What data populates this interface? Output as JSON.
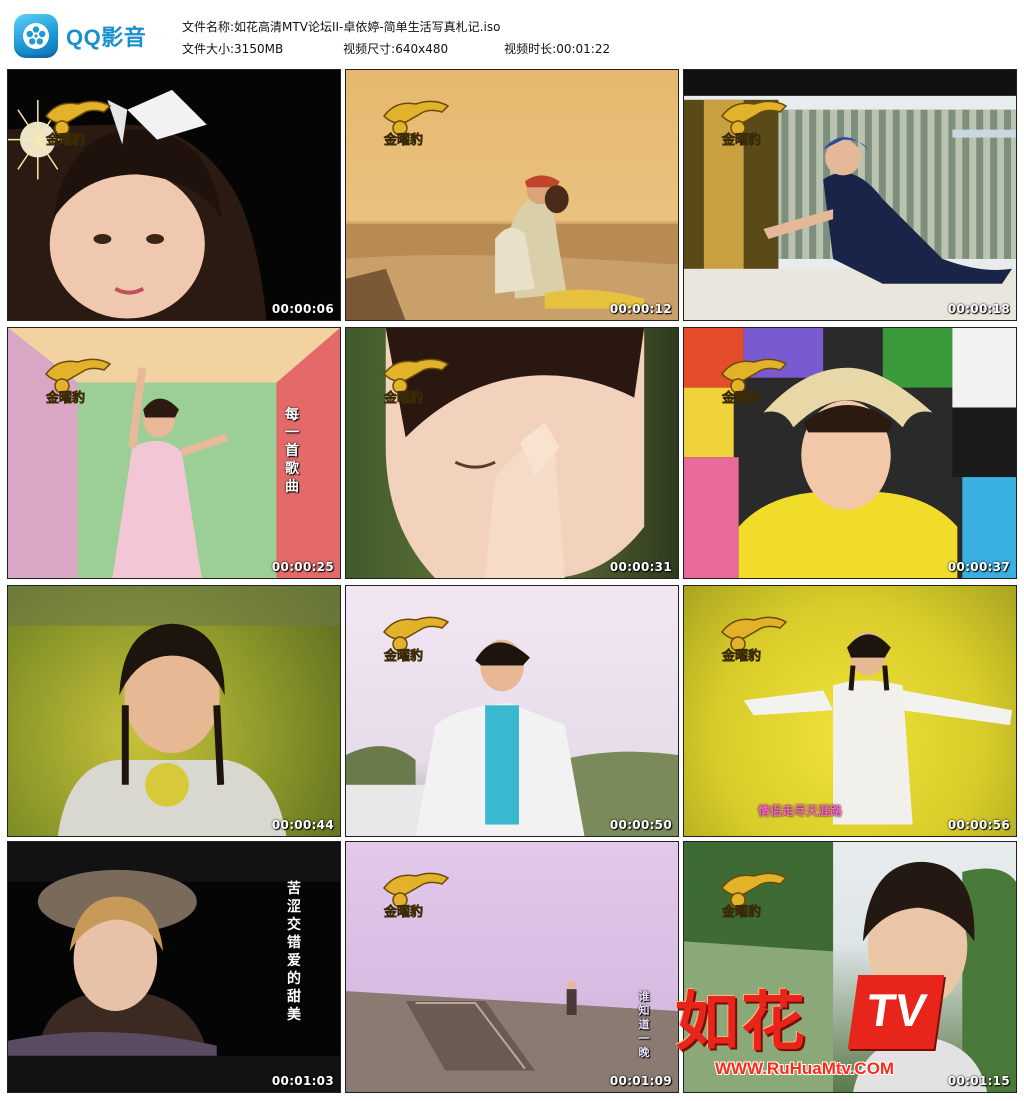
{
  "app": {
    "name": "QQ影音",
    "logo_icon": "film-reel-icon",
    "brand_color": "#1a8fd0"
  },
  "file_info": {
    "name_label": "文件名称:",
    "name_value": "如花高清MTV论坛II-卓依婷-简单生活写真札记.iso",
    "size_label": "文件大小:",
    "size_value": "3150MB",
    "dimensions_label": "视频尺寸:",
    "dimensions_value": "640x480",
    "duration_label": "视频时长:",
    "duration_value": "00:01:22"
  },
  "thumbnails": [
    {
      "timestamp": "00:00:06",
      "logo": "金曜豹",
      "caption": ""
    },
    {
      "timestamp": "00:00:12",
      "logo": "金曜豹",
      "caption": ""
    },
    {
      "timestamp": "00:00:18",
      "logo": "金曜豹",
      "caption": ""
    },
    {
      "timestamp": "00:00:25",
      "logo": "金曜豹",
      "caption": "每一首歌曲"
    },
    {
      "timestamp": "00:00:31",
      "logo": "金曜豹",
      "caption": ""
    },
    {
      "timestamp": "00:00:37",
      "logo": "金曜豹",
      "caption": ""
    },
    {
      "timestamp": "00:00:44",
      "logo": "",
      "caption": ""
    },
    {
      "timestamp": "00:00:50",
      "logo": "金曜豹",
      "caption": ""
    },
    {
      "timestamp": "00:00:56",
      "logo": "金曜豹",
      "caption": "情侣走尽天涯路"
    },
    {
      "timestamp": "00:01:03",
      "logo": "",
      "caption": "苦涩交错爱的甜美"
    },
    {
      "timestamp": "00:01:09",
      "logo": "金曜豹",
      "caption": "谁知道一晚"
    },
    {
      "timestamp": "00:01:15",
      "logo": "金曜豹",
      "caption": ""
    }
  ],
  "watermark": {
    "title": "如花",
    "badge": "TV",
    "url": "WWW.RuHuaMtv.COM"
  }
}
